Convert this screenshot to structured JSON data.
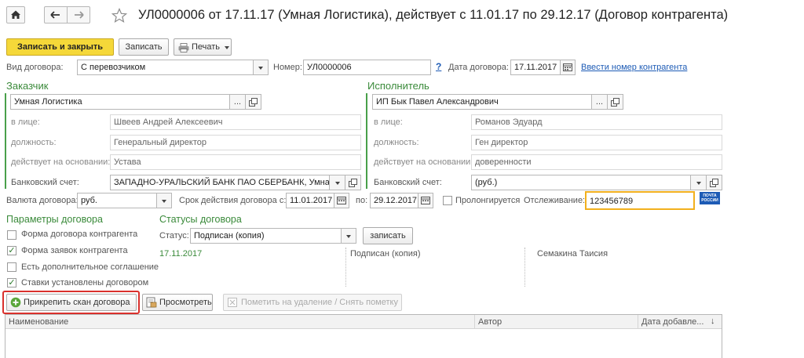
{
  "header": {
    "title": "УЛ0000006 от 17.11.17 (Умная Логистика), действует с 11.01.17 по 29.12.17 (Договор контрагента)"
  },
  "toolbar": {
    "save_close": "Записать и закрыть",
    "save": "Записать",
    "print": "Печать"
  },
  "contract": {
    "type_label": "Вид договора:",
    "type_value": "С перевозчиком",
    "number_label": "Номер:",
    "number_value": "УЛ0000006",
    "help": "?",
    "date_label": "Дата договора:",
    "date_value": "17.11.2017",
    "enter_number_link": "Ввести номер контрагента"
  },
  "customer": {
    "header": "Заказчик",
    "name": "Умная Логистика",
    "person_label": "в лице:",
    "person": "Швеев Андрей Алексеевич",
    "position_label": "должность:",
    "position": "Генеральный директор",
    "basis_label": "действует на основании:",
    "basis": "Устава",
    "bank_label": "Банковский счет:",
    "bank": "ЗАПАДНО-УРАЛЬСКИЙ БАНК ПАО СБЕРБАНК, Умная"
  },
  "contractor": {
    "header": "Исполнитель",
    "name": "ИП Бык Павел Александрович",
    "person_label": "в лице:",
    "person": "Романов Эдуард",
    "position_label": "должность:",
    "position": "Ген директор",
    "basis_label": "действует на основании:",
    "basis": "доверенности",
    "bank_label": "Банковский счет:",
    "bank": "(руб.)"
  },
  "terms": {
    "currency_label": "Валюта договора:",
    "currency": "руб.",
    "period_label": "Срок действия договора с:",
    "date_from": "11.01.2017",
    "to_label": "по:",
    "date_to": "29.12.2017",
    "prolong_label": "Пролонгируется",
    "tracking_label": "Отслеживание:",
    "tracking_value": "123456789",
    "post_logo_line1": "ПОЧТА",
    "post_logo_line2": "РОССИИ"
  },
  "params": {
    "header": "Параметры договора",
    "items": [
      {
        "label": "Форма договора контрагента",
        "checked": false
      },
      {
        "label": "Форма заявок контрагента",
        "checked": true
      },
      {
        "label": "Есть дополнительное соглашение",
        "checked": false
      },
      {
        "label": "Ставки установлены договором",
        "checked": true
      }
    ]
  },
  "statuses": {
    "header": "Статусы договора",
    "status_label": "Статус:",
    "status_value": "Подписан (копия)",
    "write_button": "записать",
    "row": {
      "date": "17.11.2017",
      "status": "Подписан (копия)",
      "author": "Семакина Таисия"
    }
  },
  "files": {
    "attach": "Прикрепить скан договора",
    "view": "Просмотреть",
    "mark_delete": "Пометить на удаление / Снять пометку",
    "columns": [
      "Наименование",
      "Автор",
      "Дата добавле..."
    ]
  },
  "colors": {
    "accent_yellow": "#f5d839",
    "section_green": "#3a8a3a",
    "link_blue": "#1d5bb5",
    "highlight_red": "#d9302c",
    "focus_orange": "#f2b01e"
  }
}
